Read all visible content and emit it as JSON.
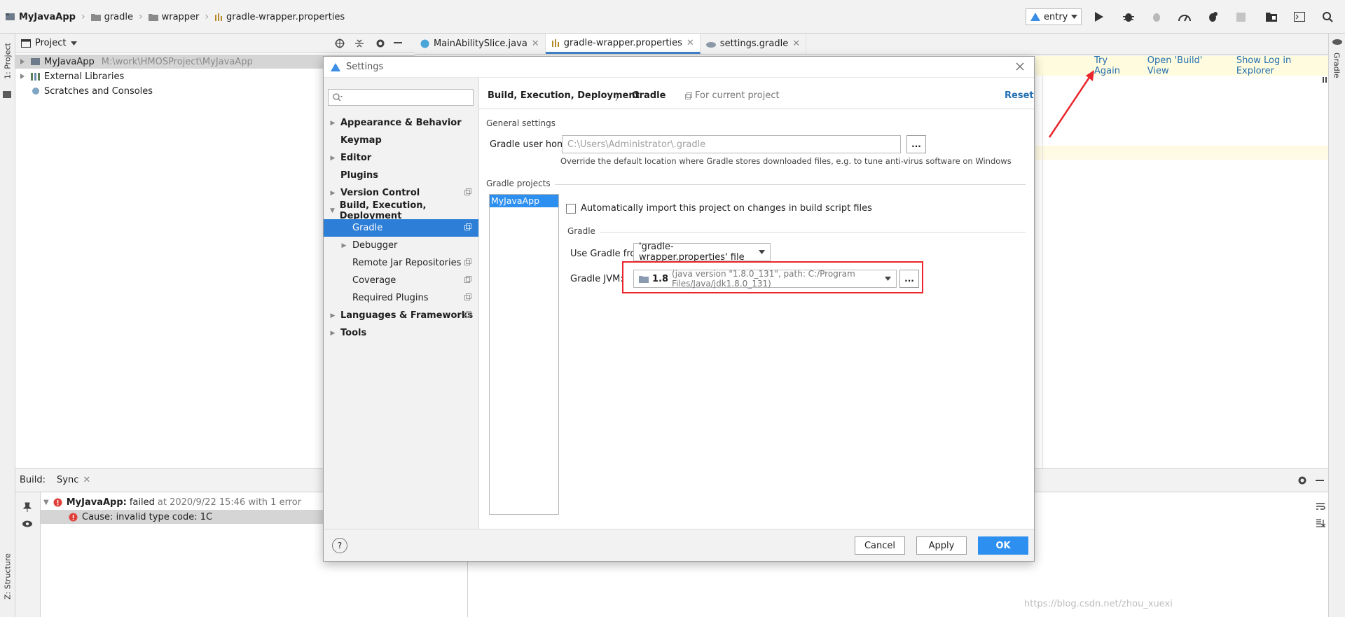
{
  "breadcrumb": [
    "MyJavaApp",
    "gradle",
    "wrapper",
    "gradle-wrapper.properties"
  ],
  "toolbar": {
    "run_config": "entry"
  },
  "left_strip": {
    "project_tab": "1: Project",
    "structure_tab": "Z: Structure"
  },
  "right_strip": {
    "gradle_tab": "Gradle"
  },
  "project": {
    "header": "Project",
    "tree": [
      {
        "label": "MyJavaApp",
        "path": "M:\\work\\HMOSProject\\MyJavaApp"
      },
      {
        "label": "External Libraries"
      },
      {
        "label": "Scratches and Consoles"
      }
    ]
  },
  "editor_tabs": [
    "MainAbilitySlice.java",
    "gradle-wrapper.properties",
    "settings.gradle"
  ],
  "notification": {
    "try_again": "Try Again",
    "open_build": "Open 'Build' View",
    "show_log": "Show Log in Explorer"
  },
  "build": {
    "label": "Build:",
    "tab": "Sync",
    "row1_name": "MyJavaApp:",
    "row1_status": "failed",
    "row1_detail": "at 2020/9/22 15:46 with 1 error",
    "row2": "Cause: invalid type code: 1C"
  },
  "settings": {
    "title": "Settings",
    "search_placeholder": "",
    "nav": [
      "Appearance & Behavior",
      "Keymap",
      "Editor",
      "Plugins",
      "Version Control",
      "Build, Execution, Deployment",
      "Gradle",
      "Debugger",
      "Remote Jar Repositories",
      "Coverage",
      "Required Plugins",
      "Languages & Frameworks",
      "Tools"
    ],
    "content_breadcrumb_1": "Build, Execution, Deployment",
    "content_breadcrumb_2": "Gradle",
    "for_current_project": "For current project",
    "reset": "Reset",
    "general_settings": "General settings",
    "gradle_user_home_label": "Gradle user home:",
    "gradle_user_home_value": "C:\\Users\\Administrator\\.gradle",
    "gradle_user_home_hint": "Override the default location where Gradle stores downloaded files, e.g. to tune anti-virus software on Windows",
    "gradle_projects": "Gradle projects",
    "project_item": "MyJavaApp",
    "auto_import": "Automatically import this project on changes in build script files",
    "gradle_section": "Gradle",
    "use_gradle_from_label": "Use Gradle from:",
    "use_gradle_from_value": "'gradle-wrapper.properties' file",
    "gradle_jvm_label": "Gradle JVM:",
    "gradle_jvm_version": "1.8",
    "gradle_jvm_detail": "(java version \"1.8.0_131\", path: C:/Program Files/Java/jdk1.8.0_131)",
    "dots": "...",
    "help": "?",
    "cancel": "Cancel",
    "apply": "Apply",
    "ok": "OK"
  },
  "watermark": "https://blog.csdn.net/zhou_xuexi",
  "colors": {
    "accent": "#2d7ed6",
    "highlight_box": "#e8262b",
    "error": "#e0403a",
    "link": "#2470b3"
  }
}
